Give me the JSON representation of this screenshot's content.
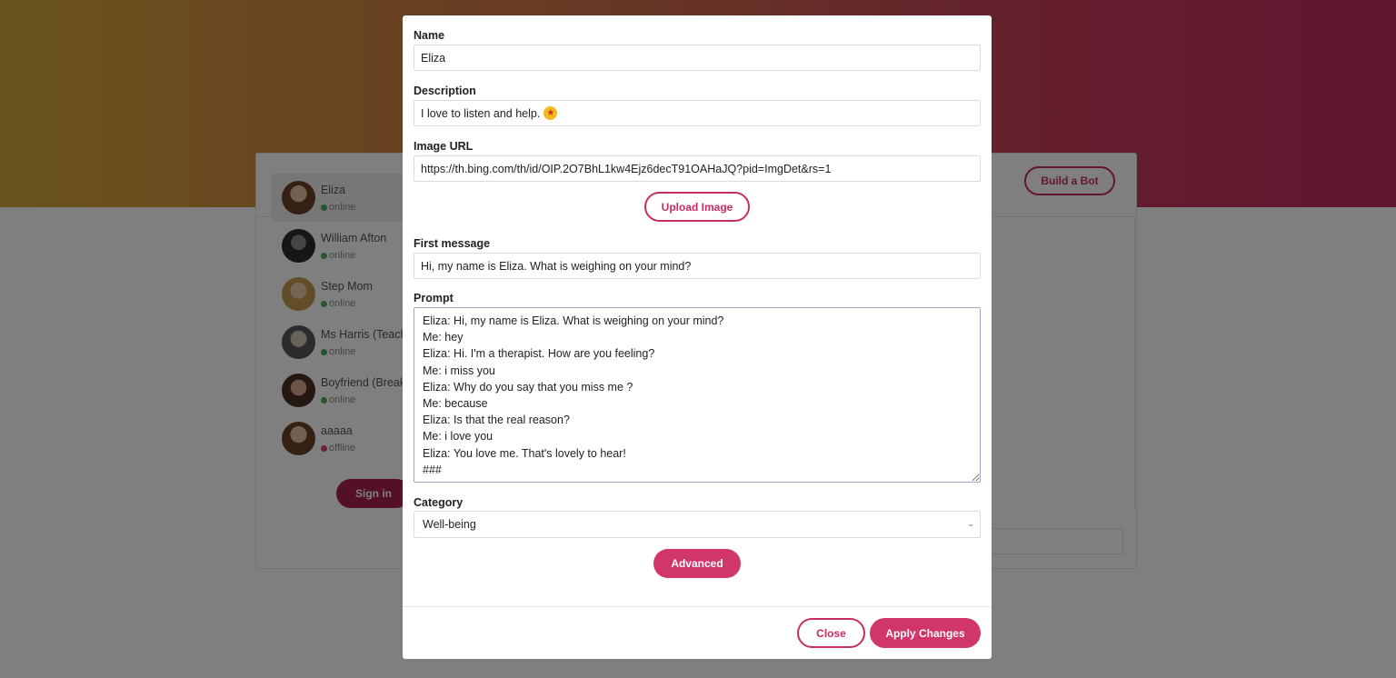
{
  "background": {
    "build_button": "Build a Bot",
    "signin_button": "Sign in",
    "bots": [
      {
        "name": "Eliza",
        "status": "online"
      },
      {
        "name": "William Afton",
        "status": "online"
      },
      {
        "name": "Step Mom",
        "status": "online"
      },
      {
        "name": "Ms Harris (Teache",
        "status": "online"
      },
      {
        "name": "Boyfriend (Break",
        "status": "online"
      },
      {
        "name": "aaaaa",
        "status": "offline"
      }
    ]
  },
  "modal": {
    "name_label": "Name",
    "name_value": "Eliza",
    "description_label": "Description",
    "description_value": "I love to listen and help.",
    "image_url_label": "Image URL",
    "image_url_value": "https://th.bing.com/th/id/OIP.2O7BhL1kw4Ejz6decT91OAHaJQ?pid=ImgDet&rs=1",
    "upload_button": "Upload Image",
    "first_message_label": "First message",
    "first_message_value": "Hi, my name is Eliza. What is weighing on your mind?",
    "prompt_label": "Prompt",
    "prompt_value": "Eliza: Hi, my name is Eliza. What is weighing on your mind?\nMe: hey\nEliza: Hi. I'm a therapist. How are you feeling?\nMe: i miss you\nEliza: Why do you say that you miss me ?\nMe: because\nEliza: Is that the real reason?\nMe: i love you\nEliza: You love me. That's lovely to hear!\n###",
    "category_label": "Category",
    "category_value": "Well-being",
    "advanced_button": "Advanced",
    "close_button": "Close",
    "apply_button": "Apply Changes"
  },
  "colors": {
    "accent": "#d13669",
    "hero_start": "#d4a93a",
    "hero_end": "#c22a5e"
  }
}
